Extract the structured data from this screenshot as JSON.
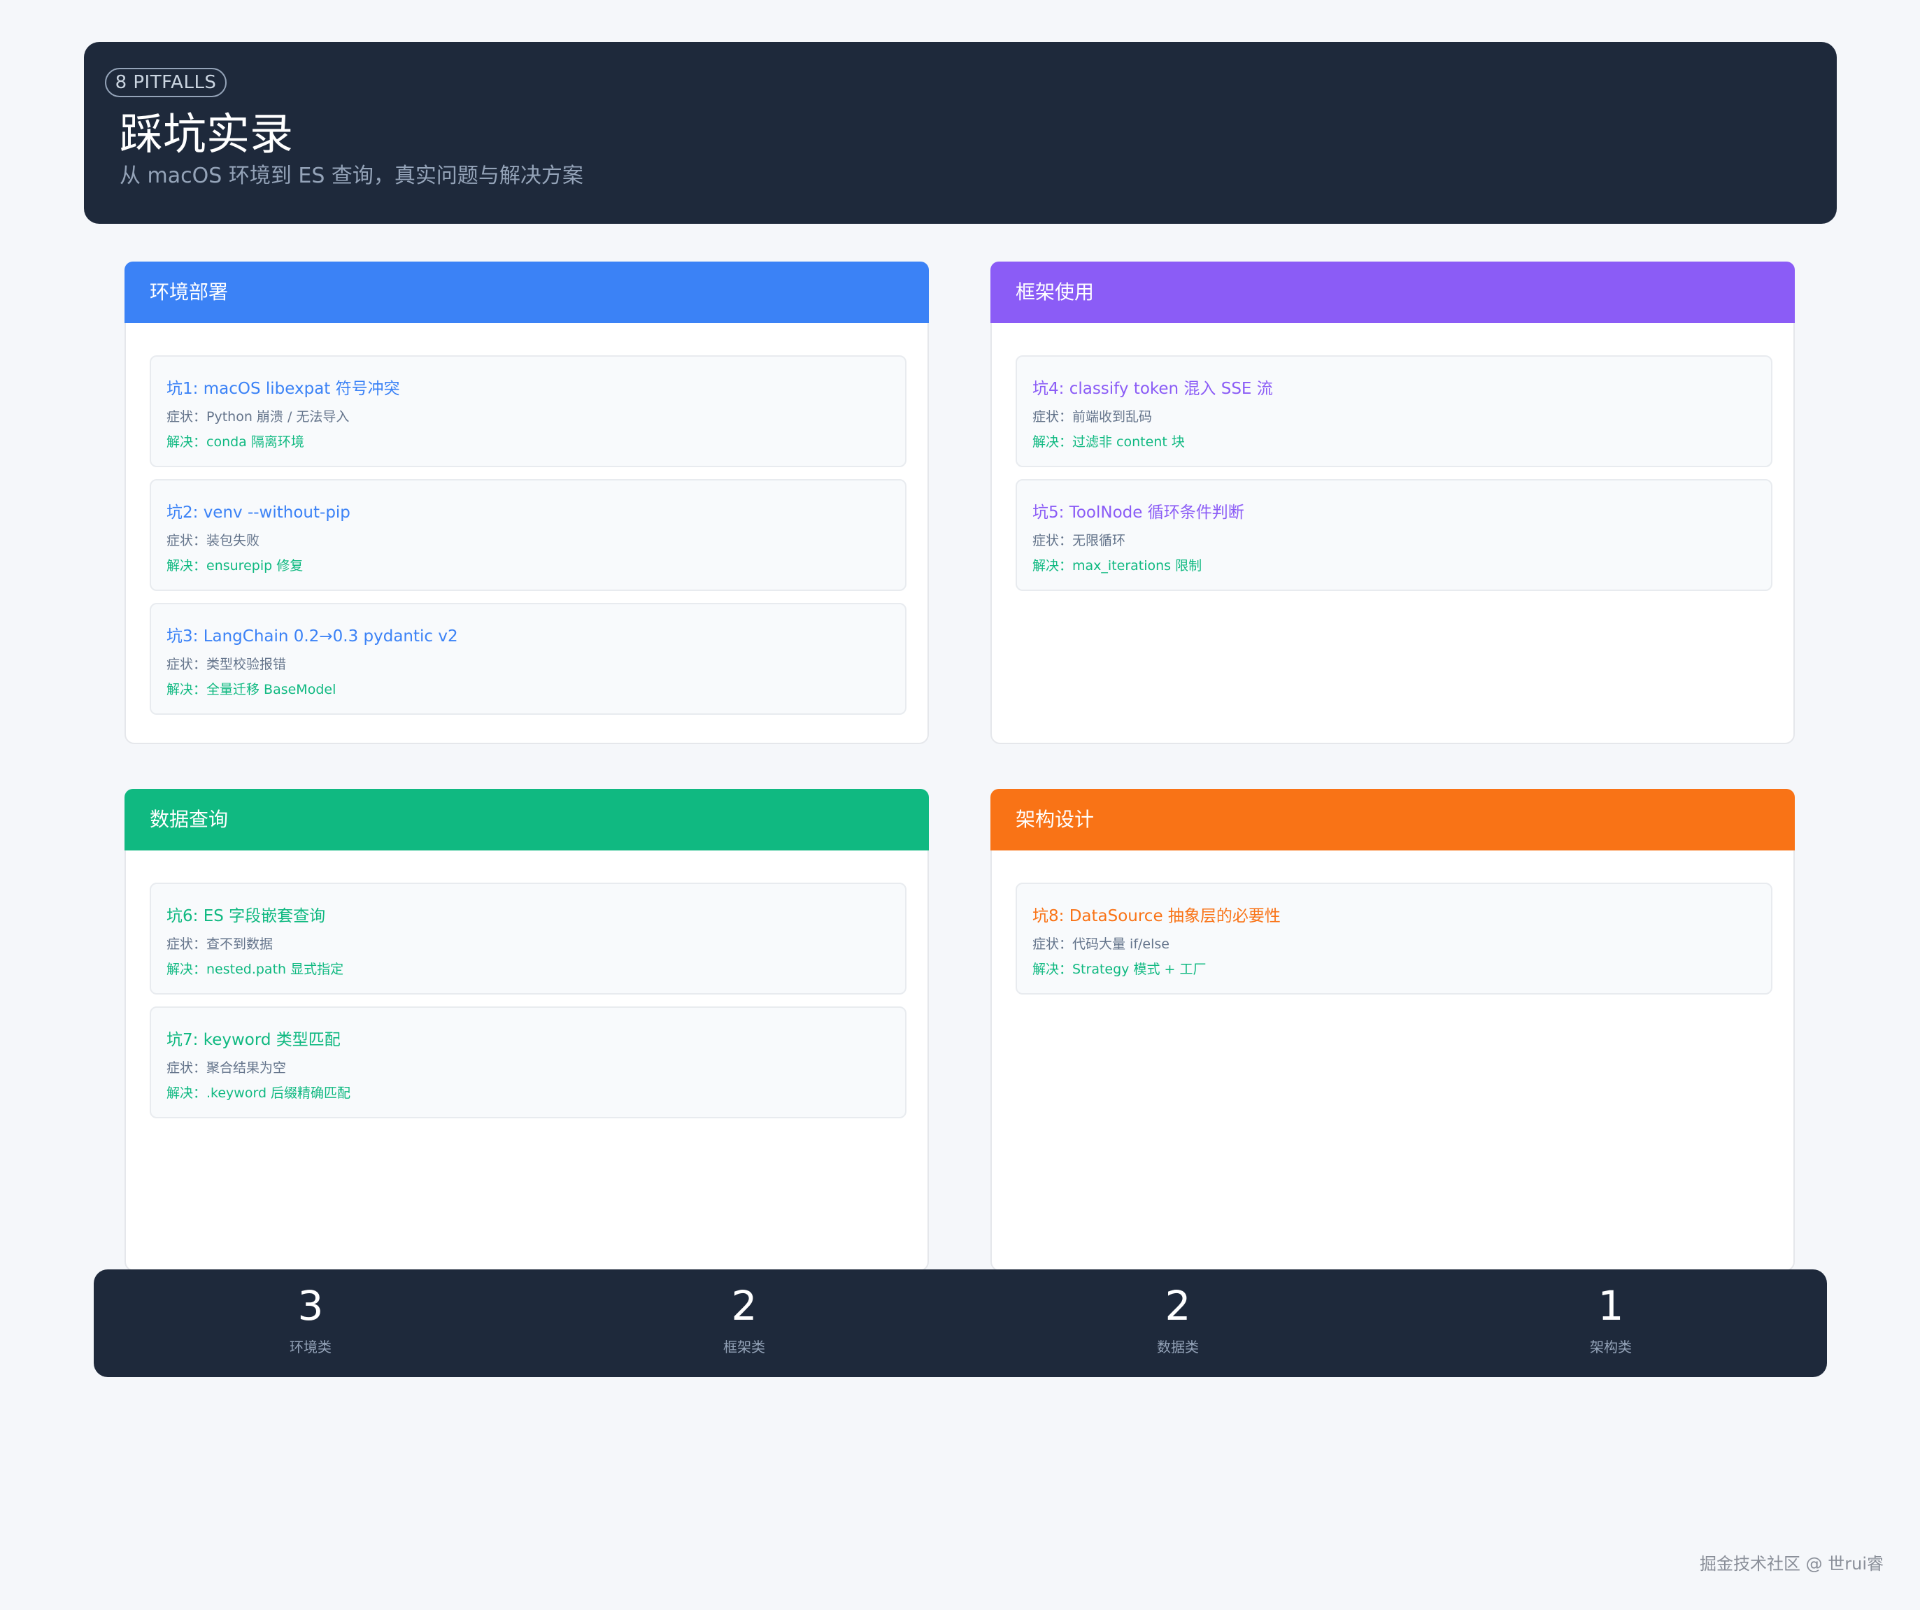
{
  "header": {
    "badge": "8 PITFALLS",
    "title": "踩坑实录",
    "subtitle": "从 macOS 环境到 ES 查询，真实问题与解决方案"
  },
  "colors": {
    "env": "#3b82f6",
    "framework": "#8b5cf6",
    "data": "#10b981",
    "arch": "#f97316",
    "dark": "#1e293b"
  },
  "sections": [
    {
      "title": "环境部署",
      "items": [
        {
          "title": "坑1: macOS libexpat 符号冲突",
          "symptom": "症状：Python 崩溃 / 无法导入",
          "solution": "解决：conda 隔离环境"
        },
        {
          "title": "坑2: venv --without-pip",
          "symptom": "症状：装包失败",
          "solution": "解决：ensurepip 修复"
        },
        {
          "title": "坑3: LangChain 0.2→0.3 pydantic v2",
          "symptom": "症状：类型校验报错",
          "solution": "解决：全量迁移 BaseModel"
        }
      ]
    },
    {
      "title": "框架使用",
      "items": [
        {
          "title": "坑4: classify token 混入 SSE 流",
          "symptom": "症状：前端收到乱码",
          "solution": "解决：过滤非 content 块"
        },
        {
          "title": "坑5: ToolNode 循环条件判断",
          "symptom": "症状：无限循环",
          "solution": "解决：max_iterations 限制"
        }
      ]
    },
    {
      "title": "数据查询",
      "items": [
        {
          "title": "坑6: ES 字段嵌套查询",
          "symptom": "症状：查不到数据",
          "solution": "解决：nested.path 显式指定"
        },
        {
          "title": "坑7: keyword 类型匹配",
          "symptom": "症状：聚合结果为空",
          "solution": "解决：.keyword 后缀精确匹配"
        }
      ]
    },
    {
      "title": "架构设计",
      "items": [
        {
          "title": "坑8: DataSource 抽象层的必要性",
          "symptom": "症状：代码大量 if/else",
          "solution": "解决：Strategy 模式 + 工厂"
        }
      ]
    }
  ],
  "stats": [
    {
      "value": "3",
      "label": "环境类"
    },
    {
      "value": "2",
      "label": "框架类"
    },
    {
      "value": "2",
      "label": "数据类"
    },
    {
      "value": "1",
      "label": "架构类"
    }
  ],
  "watermark": "掘金技术社区 @ 世rui睿"
}
